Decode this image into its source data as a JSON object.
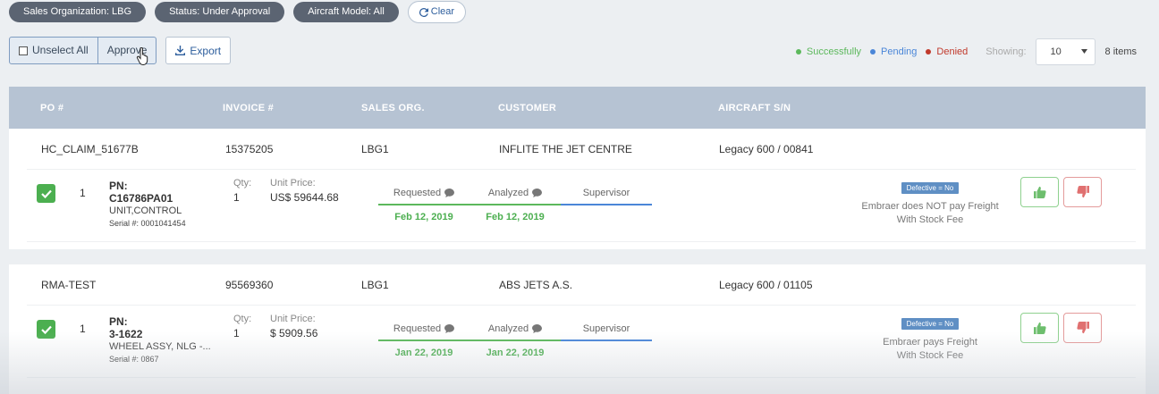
{
  "filters": {
    "chips": [
      "Sales Organization: LBG",
      "Status: Under Approval",
      "Aircraft Model: All"
    ],
    "clear_label": "Clear"
  },
  "toolbar": {
    "unselect_label": "Unselect All",
    "approve_label": "Approve",
    "export_label": "Export"
  },
  "legend": {
    "successfully": "Successfully",
    "pending": "Pending",
    "denied": "Denied",
    "showing_label": "Showing:",
    "page_size": "10",
    "items_count": "8 items",
    "colors": {
      "successfully": "#5cb85c",
      "pending": "#4a86d8",
      "denied": "#c0392b"
    }
  },
  "table": {
    "headers": [
      "PO #",
      "INVOICE #",
      "SALES ORG.",
      "CUSTOMER",
      "AIRCRAFT S/N"
    ]
  },
  "orders": [
    {
      "po": "HC_CLAIM_51677B",
      "invoice": "15375205",
      "sales_org": "LBG1",
      "customer": "INFLITE THE JET CENTRE",
      "aircraft": "Legacy 600 / 00841",
      "item": {
        "line": "1",
        "pn_label": "PN:",
        "pn": "C16786PA01",
        "description": "UNIT,CONTROL",
        "serial": "Serial #: 0001041454",
        "qty_label": "Qty:",
        "qty": "1",
        "price_label": "Unit Price:",
        "price": "US$ 59644.68",
        "steps": [
          {
            "name": "Requested",
            "date": "Feb 12, 2019",
            "state": "done"
          },
          {
            "name": "Analyzed",
            "date": "Feb 12, 2019",
            "state": "done"
          },
          {
            "name": "Supervisor",
            "date": "",
            "state": "pending"
          }
        ],
        "badge": "Defective = No",
        "freight_line1": "Embraer does NOT pay Freight",
        "freight_line2": "With Stock Fee"
      }
    },
    {
      "po": "RMA-TEST",
      "invoice": "95569360",
      "sales_org": "LBG1",
      "customer": "ABS JETS A.S.",
      "aircraft": "Legacy 600 / 01105",
      "item": {
        "line": "1",
        "pn_label": "PN:",
        "pn": "3-1622",
        "description": "WHEEL ASSY, NLG -...",
        "serial": "Serial #: 0867",
        "qty_label": "Qty:",
        "qty": "1",
        "price_label": "Unit Price:",
        "price": "$ 5909.56",
        "steps": [
          {
            "name": "Requested",
            "date": "Jan 22, 2019",
            "state": "done"
          },
          {
            "name": "Analyzed",
            "date": "Jan 22, 2019",
            "state": "done"
          },
          {
            "name": "Supervisor",
            "date": "",
            "state": "pending"
          }
        ],
        "badge": "Defective = No",
        "freight_line1": "Embraer pays Freight",
        "freight_line2": "With Stock Fee"
      }
    }
  ]
}
